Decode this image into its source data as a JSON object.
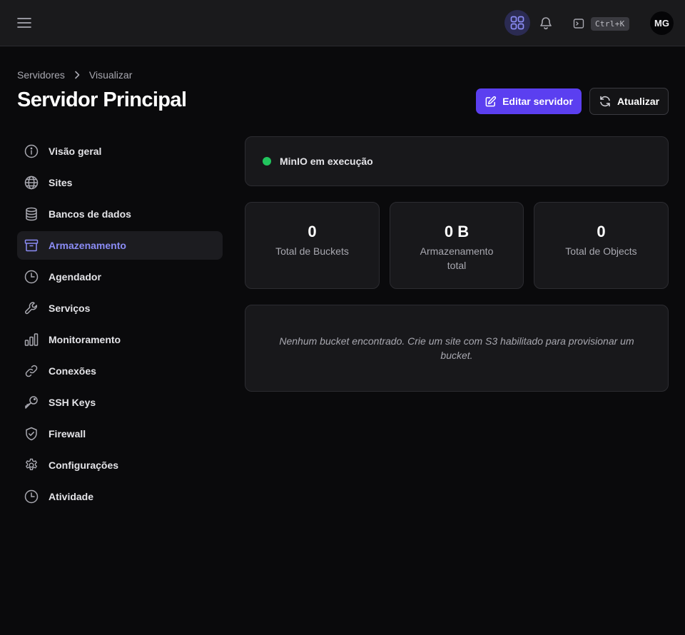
{
  "header": {
    "shortcut_label": "Ctrl+K",
    "avatar_initials": "MG"
  },
  "breadcrumb": {
    "parent": "Servidores",
    "current": "Visualizar"
  },
  "page": {
    "title": "Servidor Principal",
    "edit_label": "Editar servidor",
    "refresh_label": "Atualizar"
  },
  "sidebar": {
    "items": [
      {
        "label": "Visão geral",
        "icon": "info-icon"
      },
      {
        "label": "Sites",
        "icon": "globe-icon"
      },
      {
        "label": "Bancos de dados",
        "icon": "database-icon"
      },
      {
        "label": "Armazenamento",
        "icon": "archive-icon",
        "active": true
      },
      {
        "label": "Agendador",
        "icon": "clock-icon"
      },
      {
        "label": "Serviços",
        "icon": "wrench-icon"
      },
      {
        "label": "Monitoramento",
        "icon": "bar-chart-icon"
      },
      {
        "label": "Conexões",
        "icon": "link-icon"
      },
      {
        "label": "SSH Keys",
        "icon": "key-icon"
      },
      {
        "label": "Firewall",
        "icon": "shield-check-icon"
      },
      {
        "label": "Configurações",
        "icon": "gear-icon"
      },
      {
        "label": "Atividade",
        "icon": "clock-icon"
      }
    ]
  },
  "status": {
    "text": "MinIO em execução",
    "color": "#22c55e"
  },
  "stats": [
    {
      "value": "0",
      "label": "Total de Buckets"
    },
    {
      "value": "0 B",
      "label": "Armazenamento total"
    },
    {
      "value": "0",
      "label": "Total de Objects"
    }
  ],
  "empty_state": {
    "text": "Nenhum bucket encontrado. Crie um site com S3 habilitado para provisionar um bucket."
  },
  "colors": {
    "accent": "#5b3ff0",
    "active_nav": "#8b8cf5",
    "background": "#0a0a0c"
  }
}
